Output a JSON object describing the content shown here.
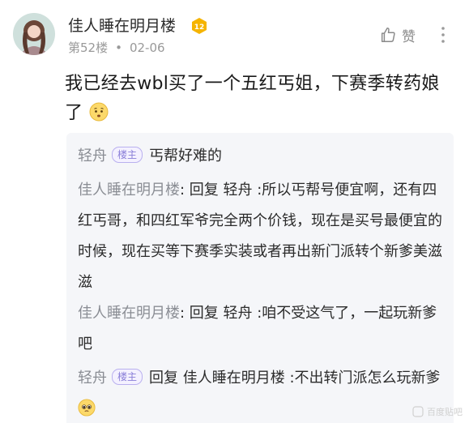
{
  "post": {
    "username": "佳人睡在明月楼",
    "level": "12",
    "floor": "第52楼",
    "date": "02-06",
    "like_label": "赞",
    "text": "我已经去wbl买了一个五红丐姐，下赛季转药娘了"
  },
  "replies": [
    {
      "name": "轻舟",
      "owner_tag": "楼主",
      "text": "丐帮好难的"
    },
    {
      "name": "佳人睡在明月楼",
      "text": "回复 轻舟 :所以丐帮号便宜啊，还有四红丐哥，和四红军爷完全两个价钱，现在是买号最便宜的时候，现在买等下赛季实装或者再出新门派转个新爹美滋滋"
    },
    {
      "name": "佳人睡在明月楼",
      "text": "回复 轻舟 :咱不受这气了，一起玩新爹吧"
    },
    {
      "name": "轻舟",
      "owner_tag": "楼主",
      "text": "回复 佳人睡在明月楼 :不出转门派怎么玩新爹"
    }
  ],
  "watermark": "百度贴吧",
  "colors": {
    "reply_bg": "#f5f6f9",
    "owner_tag": "#8a7fd8",
    "badge": "#f5b400"
  }
}
